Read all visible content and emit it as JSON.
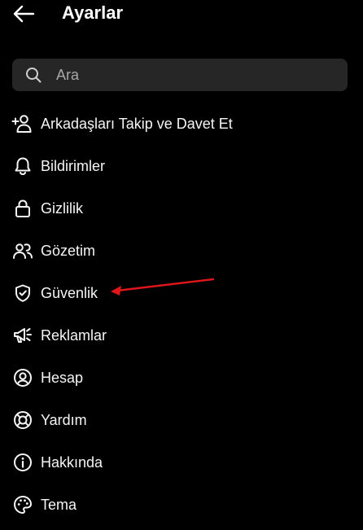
{
  "header": {
    "title": "Ayarlar",
    "back_icon": "arrow-left-icon"
  },
  "search": {
    "placeholder": "Ara",
    "value": "",
    "icon": "search-icon"
  },
  "menu": {
    "items": [
      {
        "label": "Arkadaşları Takip ve Davet Et",
        "icon": "add-person-icon"
      },
      {
        "label": "Bildirimler",
        "icon": "bell-icon"
      },
      {
        "label": "Gizlilik",
        "icon": "lock-icon"
      },
      {
        "label": "Gözetim",
        "icon": "people-icon"
      },
      {
        "label": "Güvenlik",
        "icon": "shield-check-icon"
      },
      {
        "label": "Reklamlar",
        "icon": "megaphone-icon"
      },
      {
        "label": "Hesap",
        "icon": "account-circle-icon"
      },
      {
        "label": "Yardım",
        "icon": "lifebuoy-icon"
      },
      {
        "label": "Hakkında",
        "icon": "info-icon"
      },
      {
        "label": "Tema",
        "icon": "palette-icon"
      }
    ]
  },
  "annotation": {
    "arrow_color": "#e0161b",
    "points_to": "Güvenlik"
  },
  "colors": {
    "background": "#000000",
    "search_background": "#262626",
    "text": "#f5f5f5",
    "placeholder": "#a8a8a8"
  }
}
